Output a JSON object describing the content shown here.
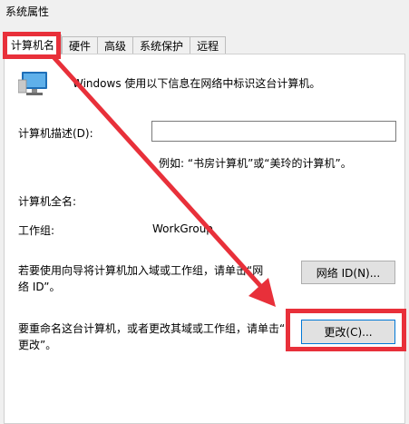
{
  "window": {
    "title": "系统属性"
  },
  "tabs": [
    {
      "label": "计算机名",
      "active": true
    },
    {
      "label": "硬件",
      "active": false
    },
    {
      "label": "高级",
      "active": false
    },
    {
      "label": "系统保护",
      "active": false
    },
    {
      "label": "远程",
      "active": false
    }
  ],
  "panel": {
    "intro": "Windows 使用以下信息在网络中标识这台计算机。",
    "description_label": "计算机描述(D):",
    "description_value": "",
    "example": "例如: “书房计算机”或“美玲的计算机”。",
    "fullname_label": "计算机全名:",
    "fullname_value": "",
    "workgroup_label": "工作组:",
    "workgroup_value": "WorkGroup",
    "network_text_1": "若要使用向导将计算机加入域或工作组，请单击“网",
    "network_text_2": "络 ID”。",
    "network_button": "网络 ID(N)...",
    "rename_text_1": "要重命名这台计算机，或者更改其域或工作组，请单击“",
    "rename_text_2": "更改”。",
    "change_button": "更改(C)..."
  },
  "colors": {
    "highlight": "#e8303a",
    "panel_bg": "#ffffff",
    "window_bg": "#f0f0f0"
  },
  "icons": {
    "computer": "computer-monitor-icon"
  }
}
